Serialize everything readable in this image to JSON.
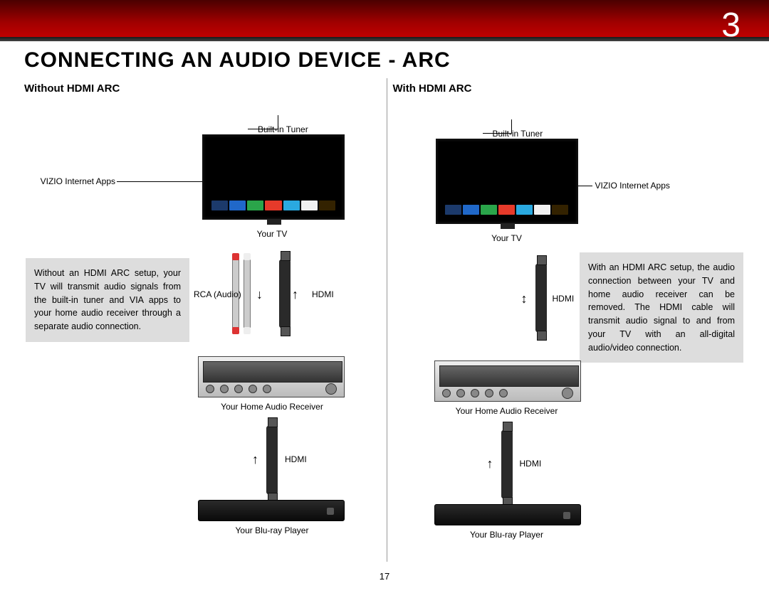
{
  "chapter": "3",
  "title": "CONNECTING AN AUDIO DEVICE - ARC",
  "page_number": "17",
  "left": {
    "subhead": "Without HDMI ARC",
    "description": "Without an HDMI ARC setup, your TV will transmit audio signals from the built-in tuner and VIA apps to your home audio receiver through a separate audio connection.",
    "callouts": {
      "tuner": "Built-in Tuner",
      "apps": "VIZIO Internet Apps"
    },
    "labels": {
      "tv": "Your TV",
      "receiver": "Your Home Audio Receiver",
      "bluray": "Your Blu-ray Player",
      "rca": "RCA (Audio)",
      "hdmi1": "HDMI",
      "hdmi2": "HDMI"
    }
  },
  "right": {
    "subhead": "With HDMI ARC",
    "description": "With an HDMI ARC setup, the audio connection between your TV and home audio receiver can be removed. The HDMI cable will transmit audio signal to and from your TV with an all-digital audio/video connection.",
    "callouts": {
      "tuner": "Built-in Tuner",
      "apps": "VIZIO Internet Apps"
    },
    "labels": {
      "tv": "Your TV",
      "receiver": "Your Home Audio Receiver",
      "bluray": "Your Blu-ray Player",
      "hdmi1": "HDMI",
      "hdmi2": "HDMI"
    }
  }
}
